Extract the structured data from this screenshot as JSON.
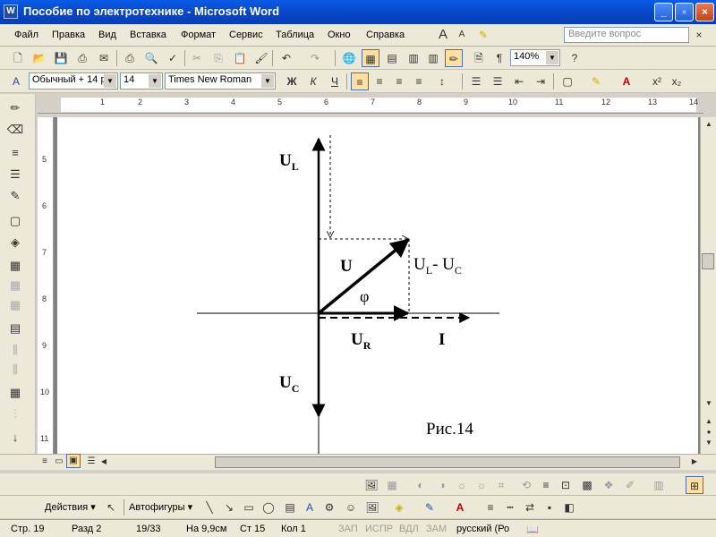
{
  "window": {
    "app_icon": "W",
    "title": "Пособие по электротехнике - Microsoft Word",
    "buttons": {
      "minimize": "_",
      "maximize": "▫",
      "close": "×"
    }
  },
  "menu": {
    "items": [
      "Файл",
      "Правка",
      "Вид",
      "Вставка",
      "Формат",
      "Сервис",
      "Таблица",
      "Окно",
      "Справка"
    ],
    "help_placeholder": "Введите вопрос"
  },
  "formatting": {
    "style": "Обычный + 14 р",
    "font_size": "14",
    "font": "Times New Roman",
    "bold": "Ж",
    "italic": "К",
    "underline": "Ч"
  },
  "standard": {
    "zoom": "140%"
  },
  "ruler": {
    "h_numbers": [
      "1",
      "2",
      "3",
      "4",
      "5",
      "6",
      "7",
      "8",
      "9",
      "10",
      "11",
      "12",
      "13",
      "14"
    ],
    "v_numbers": [
      "5",
      "6",
      "7",
      "8",
      "9",
      "10",
      "11"
    ]
  },
  "drawing_toolbar": {
    "actions_label": "Действия",
    "autoshapes_label": "Автофигуры"
  },
  "diagram": {
    "labels": {
      "ul_main": "U",
      "ul_sub": "L",
      "u": "U",
      "diff_a": "U",
      "diff_a_sub": "L",
      "diff_mid": "- U",
      "diff_b_sub": "C",
      "phi": "φ",
      "ur_main": "U",
      "ur_sub": "R",
      "i": "I",
      "uc_main": "U",
      "uc_sub": "C",
      "caption": "Рис.14"
    }
  },
  "status": {
    "page": "Стр. 19",
    "section": "Разд 2",
    "pages": "19/33",
    "at": "На 9,9см",
    "line": "Ст 15",
    "col": "Кол 1",
    "rec": "ЗАП",
    "trk": "ИСПР",
    "ext": "ВДЛ",
    "ovr": "ЗАМ",
    "lang": "русский (Ро"
  }
}
